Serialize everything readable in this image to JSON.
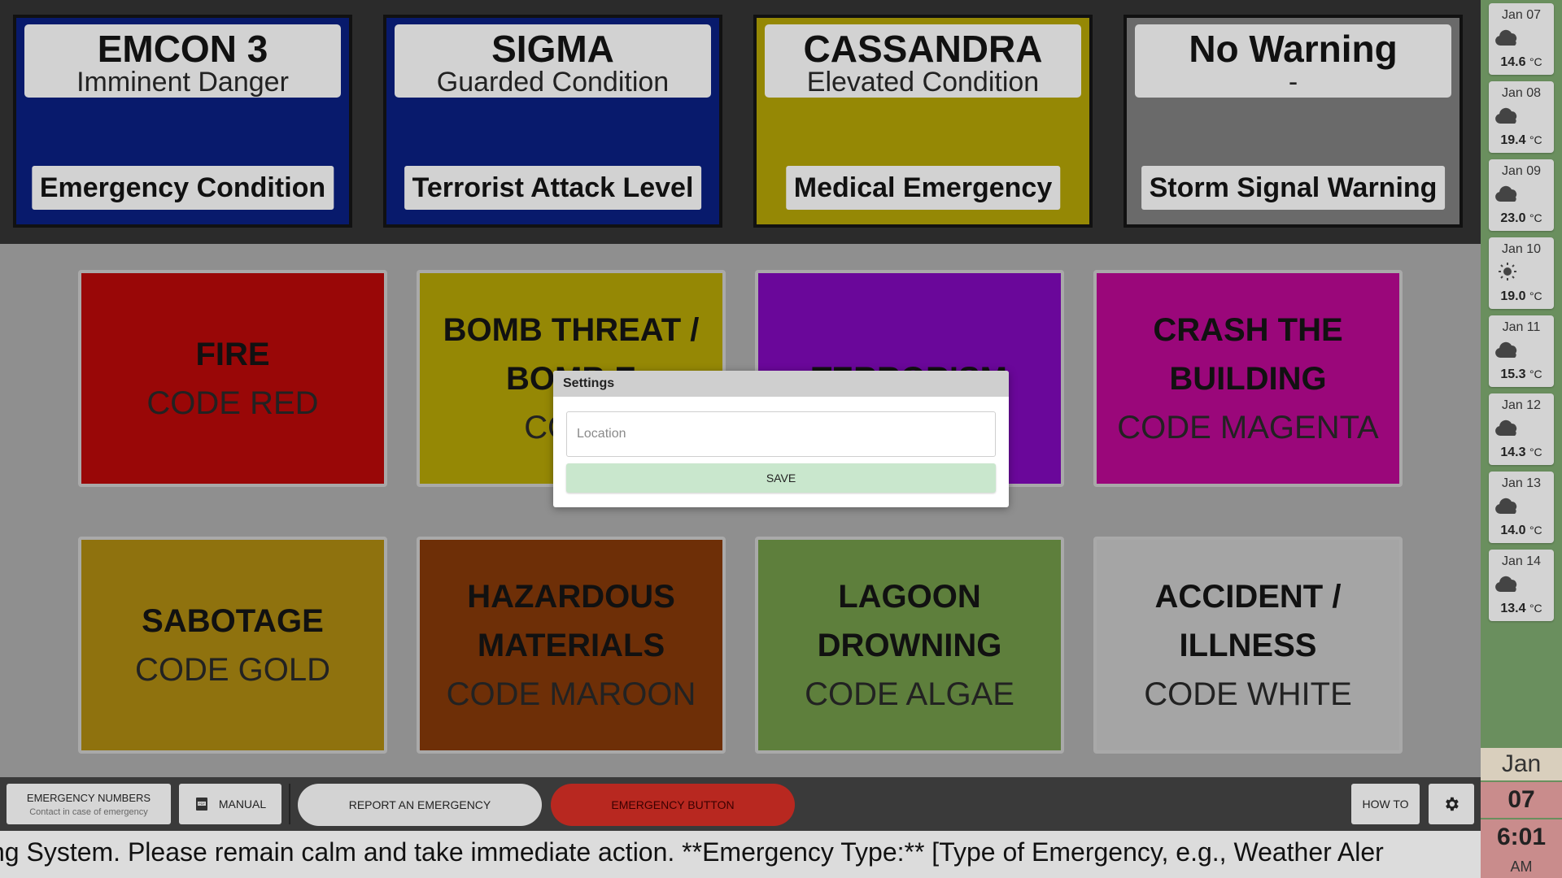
{
  "status_cards": [
    {
      "title": "EMCON 3",
      "subtitle": "Imminent Danger",
      "label": "Emergency Condition",
      "color": "#081a6c"
    },
    {
      "title": "SIGMA",
      "subtitle": "Guarded Condition",
      "label": "Terrorist Attack Level",
      "color": "#081a6c"
    },
    {
      "title": "CASSANDRA",
      "subtitle": "Elevated Condition",
      "label": "Medical Emergency",
      "color": "#958805"
    },
    {
      "title": "No Warning",
      "subtitle": "-",
      "label": "Storm Signal Warning",
      "color": "#6a6a6a"
    }
  ],
  "tiles": [
    {
      "name": "FIRE",
      "code": "CODE RED",
      "color": "#990707"
    },
    {
      "name": "BOMB THREAT / BOMB E",
      "code": "CODE",
      "color": "#958805"
    },
    {
      "name": "TERRORISM",
      "code": "",
      "color": "#6a079a"
    },
    {
      "name": "CRASH THE BUILDING",
      "code": "CODE MAGENTA",
      "color": "#9a077a"
    },
    {
      "name": "SABOTAGE",
      "code": "CODE GOLD",
      "color": "#8f720e"
    },
    {
      "name": "HAZARDOUS MATERIALS",
      "code": "CODE MAROON",
      "color": "#6e2f07"
    },
    {
      "name": "LAGOON DROWNING",
      "code": "CODE ALGAE",
      "color": "#5e7f3c"
    },
    {
      "name": "ACCIDENT / ILLNESS",
      "code": "CODE WHITE",
      "color": "#a5a5a5"
    }
  ],
  "weather": [
    {
      "date": "Jan 07",
      "icon": "cloud-icon",
      "temp": "14.6",
      "unit": "°C"
    },
    {
      "date": "Jan 08",
      "icon": "cloud-icon",
      "temp": "19.4",
      "unit": "°C"
    },
    {
      "date": "Jan 09",
      "icon": "cloud-icon",
      "temp": "23.0",
      "unit": "°C"
    },
    {
      "date": "Jan 10",
      "icon": "sun-icon",
      "temp": "19.0",
      "unit": "°C"
    },
    {
      "date": "Jan 11",
      "icon": "cloud-icon",
      "temp": "15.3",
      "unit": "°C"
    },
    {
      "date": "Jan 12",
      "icon": "cloud-icon",
      "temp": "14.3",
      "unit": "°C"
    },
    {
      "date": "Jan 13",
      "icon": "cloud-icon",
      "temp": "14.0",
      "unit": "°C"
    },
    {
      "date": "Jan 14",
      "icon": "cloud-icon",
      "temp": "13.4",
      "unit": "°C"
    }
  ],
  "clock": {
    "month": "Jan",
    "day": "07",
    "time": "6:01",
    "ampm": "AM"
  },
  "toolbar": {
    "emergency_numbers": "EMERGENCY NUMBERS",
    "emergency_numbers_sub": "Contact in case of emergency",
    "manual": "MANUAL",
    "manual_icon": "pdf-icon",
    "report": "REPORT AN EMERGENCY",
    "emergency_button": "EMERGENCY BUTTON",
    "how_to": "HOW TO",
    "settings_icon": "gear-icon"
  },
  "ticker": "ng System. Please remain calm and take immediate action. **Emergency Type:** [Type of Emergency, e.g., Weather Aler",
  "dialog": {
    "title": "Settings",
    "location_placeholder": "Location",
    "save": "SAVE"
  }
}
